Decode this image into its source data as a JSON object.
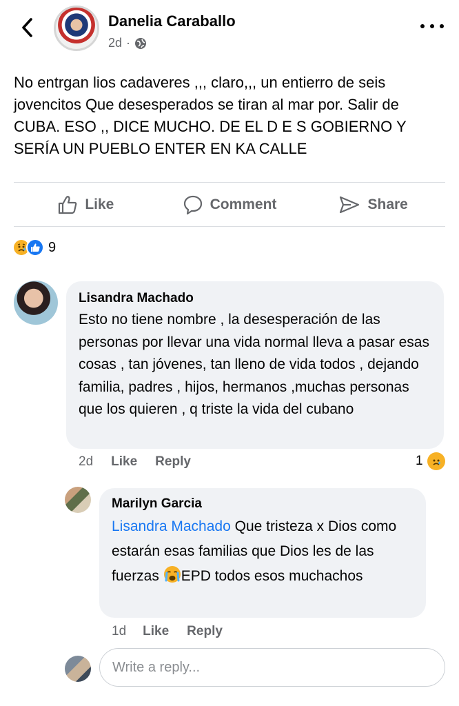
{
  "post": {
    "author": "Danelia Caraballo",
    "time": "2d",
    "separator": "·",
    "text": "No entrgan lios cadaveres ,,, claro,,, un entierro de seis jovencitos   Que desesperados se tiran al mar por. Salir de CUBA. ESO ,, DICE MUCHO. DE  EL  D E S GOBIERNO Y SERÍA UN PUEBLO ENTER EN KA CALLE",
    "actions": {
      "like": "Like",
      "comment": "Comment",
      "share": "Share"
    },
    "reaction_count": "9"
  },
  "comments": [
    {
      "author": "Lisandra Machado",
      "text": "Esto no tiene nombre , la desesperación de las personas por llevar una vida normal lleva a pasar esas cosas , tan jóvenes, tan lleno de vida todos , dejando familia, padres , hijos, hermanos ,muchas personas que los quieren , q triste la vida del cubano",
      "time": "2d",
      "like": "Like",
      "reply": "Reply",
      "reaction_count": "1"
    },
    {
      "author": "Marilyn Garcia",
      "mention": "Lisandra Machado",
      "text_before_emoji": " Que tristeza x Dios como estarán esas familias que Dios les de las fuerzas ",
      "text_after_emoji": "EPD todos esos muchachos",
      "time": "1d",
      "like": "Like",
      "reply": "Reply"
    }
  ],
  "reply_input": {
    "placeholder": "Write a reply..."
  },
  "icons": {
    "back": "chevron-left-icon",
    "more": "more-horizontal-icon",
    "audience": "globe-icon",
    "like": "thumbs-up-icon",
    "comment": "comment-bubble-icon",
    "share": "share-arrow-icon",
    "sad": "sad-reaction-icon",
    "crying": "crying-emoji-icon"
  },
  "colors": {
    "accent": "#1877f2",
    "muted": "#65676b",
    "bubble": "#f0f2f5",
    "sad": "#f7b125"
  }
}
